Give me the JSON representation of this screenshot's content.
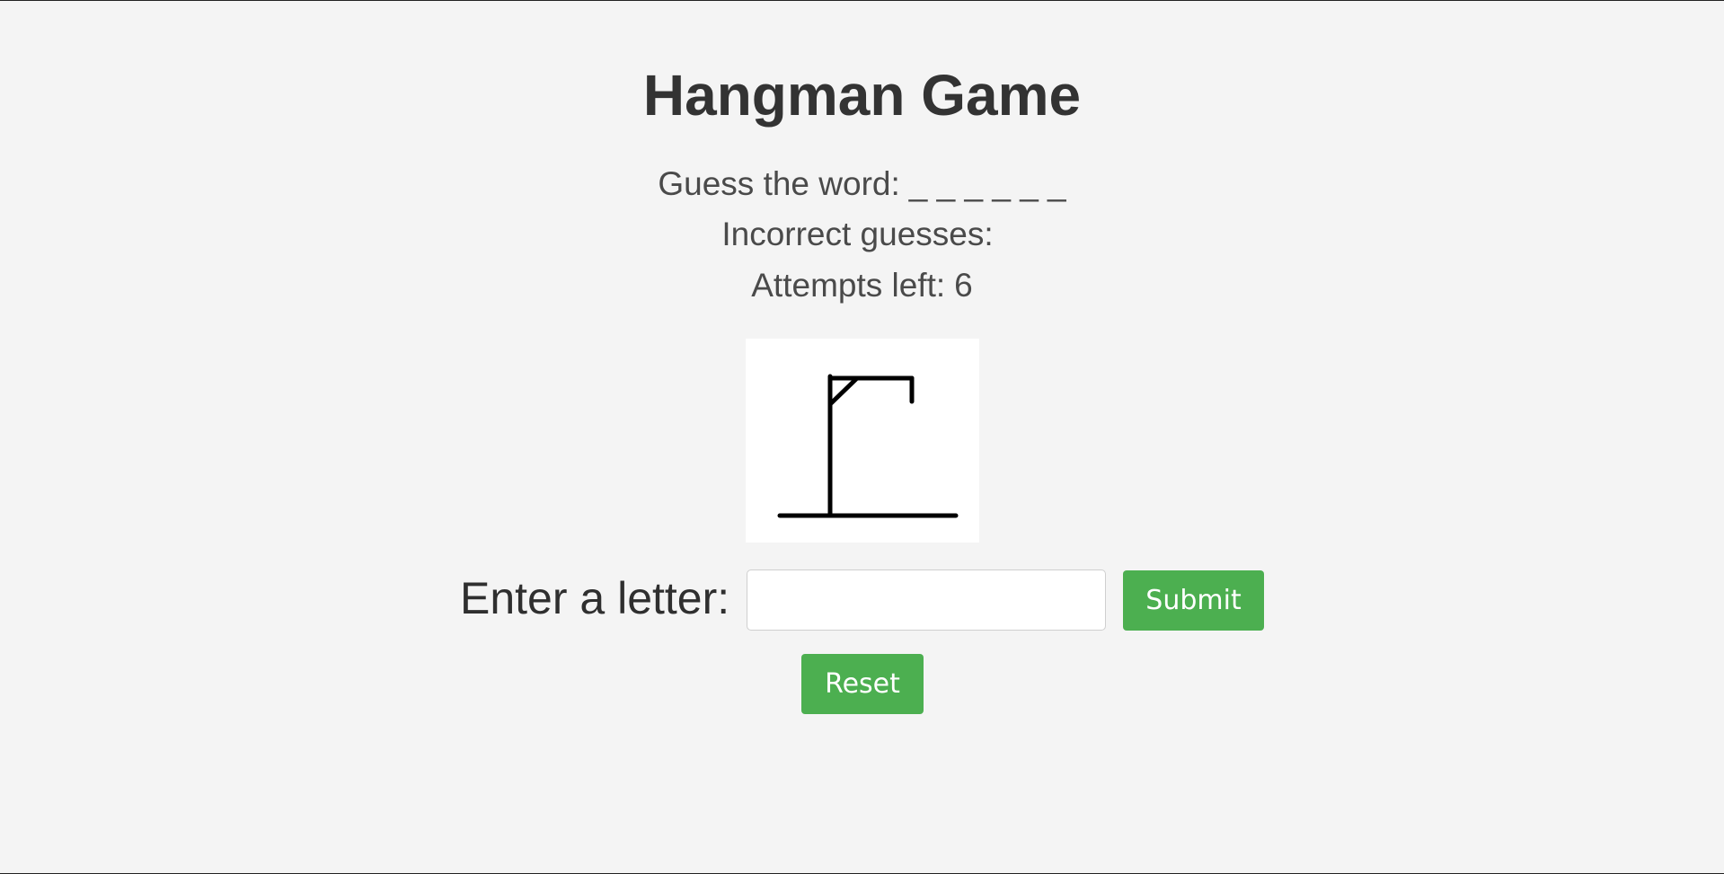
{
  "game": {
    "title": "Hangman Game",
    "word_label": "Guess the word:",
    "word_display": "_ _ _ _ _ _",
    "incorrect_label": "Incorrect guesses:",
    "incorrect_value": "",
    "attempts_label": "Attempts left:",
    "attempts_value": "6"
  },
  "form": {
    "letter_label": "Enter a letter:",
    "letter_value": "",
    "submit_label": "Submit",
    "reset_label": "Reset"
  },
  "colors": {
    "background": "#f4f4f4",
    "button": "#4caf50",
    "button_text": "#ffffff",
    "title_text": "#333333",
    "info_text": "#4a4a4a"
  },
  "hangman": {
    "parts_shown": [
      "base",
      "pole",
      "beam",
      "brace",
      "rope"
    ]
  }
}
